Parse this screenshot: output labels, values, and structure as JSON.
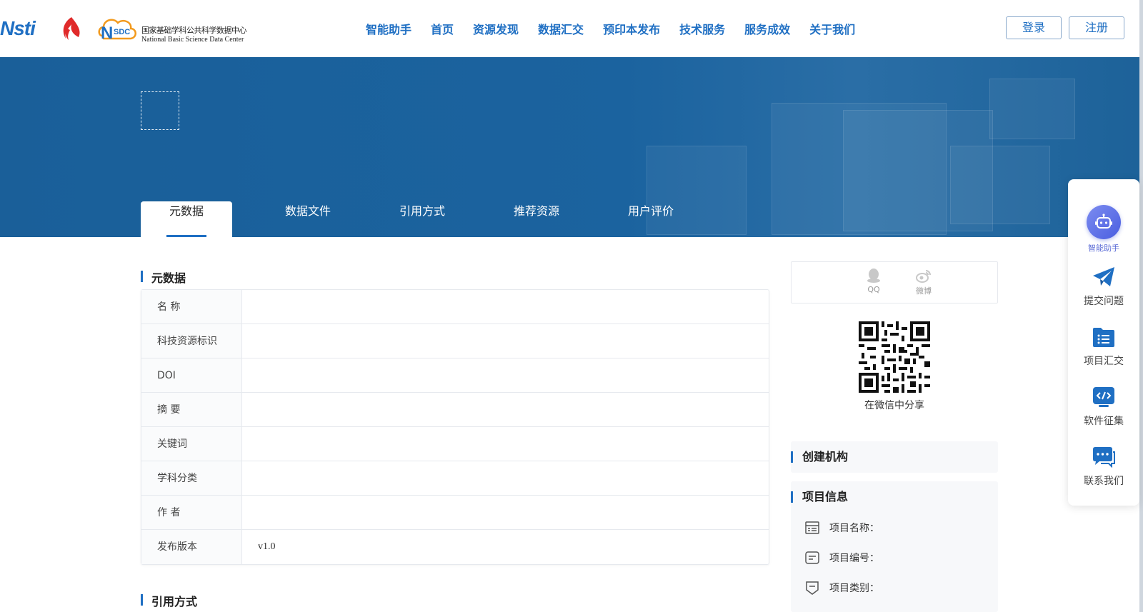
{
  "header": {
    "logos": {
      "nsti": "Nsti",
      "nsdc_cn": "国家基础学科公共科学数据中心",
      "nsdc_en": "National Basic Science Data Center"
    },
    "nav": [
      "智能助手",
      "首页",
      "资源发现",
      "数据汇交",
      "预印本发布",
      "技术服务",
      "服务成效",
      "关于我们"
    ],
    "login_label": "登录",
    "register_label": "注册"
  },
  "tabs": [
    "元数据",
    "数据文件",
    "引用方式",
    "推荐资源",
    "用户评价"
  ],
  "metadata_section": {
    "title": "元数据",
    "rows": [
      {
        "key": "名  称",
        "value": ""
      },
      {
        "key": "科技资源标识",
        "value": ""
      },
      {
        "key": "DOI",
        "value": ""
      },
      {
        "key": "摘  要",
        "value": ""
      },
      {
        "key": "关键词",
        "value": ""
      },
      {
        "key": "学科分类",
        "value": ""
      },
      {
        "key": "作  者",
        "value": ""
      },
      {
        "key": "发布版本",
        "value": "v1.0"
      }
    ]
  },
  "citation_section": {
    "title": "引用方式"
  },
  "share": {
    "qq_label": "QQ",
    "weibo_label": "微博",
    "wechat_caption": "在微信中分享"
  },
  "creator_card": {
    "title": "创建机构"
  },
  "project_card": {
    "title": "项目信息",
    "items": [
      {
        "icon": "list-card-icon",
        "label": "项目名称："
      },
      {
        "icon": "doc-lines-icon",
        "label": "项目编号："
      },
      {
        "icon": "shield-tag-icon",
        "label": "项目类别："
      }
    ]
  },
  "float_panel": {
    "items": [
      {
        "icon": "robot-icon",
        "label": "智能助手"
      },
      {
        "icon": "paper-plane-icon",
        "label": "提交问题"
      },
      {
        "icon": "folder-list-icon",
        "label": "项目汇交"
      },
      {
        "icon": "code-icon",
        "label": "软件征集"
      },
      {
        "icon": "chat-icon",
        "label": "联系我们"
      }
    ]
  },
  "colors": {
    "primary": "#1f6fc3",
    "banner": "#1b639f",
    "assistant": "#5b6bd6"
  }
}
